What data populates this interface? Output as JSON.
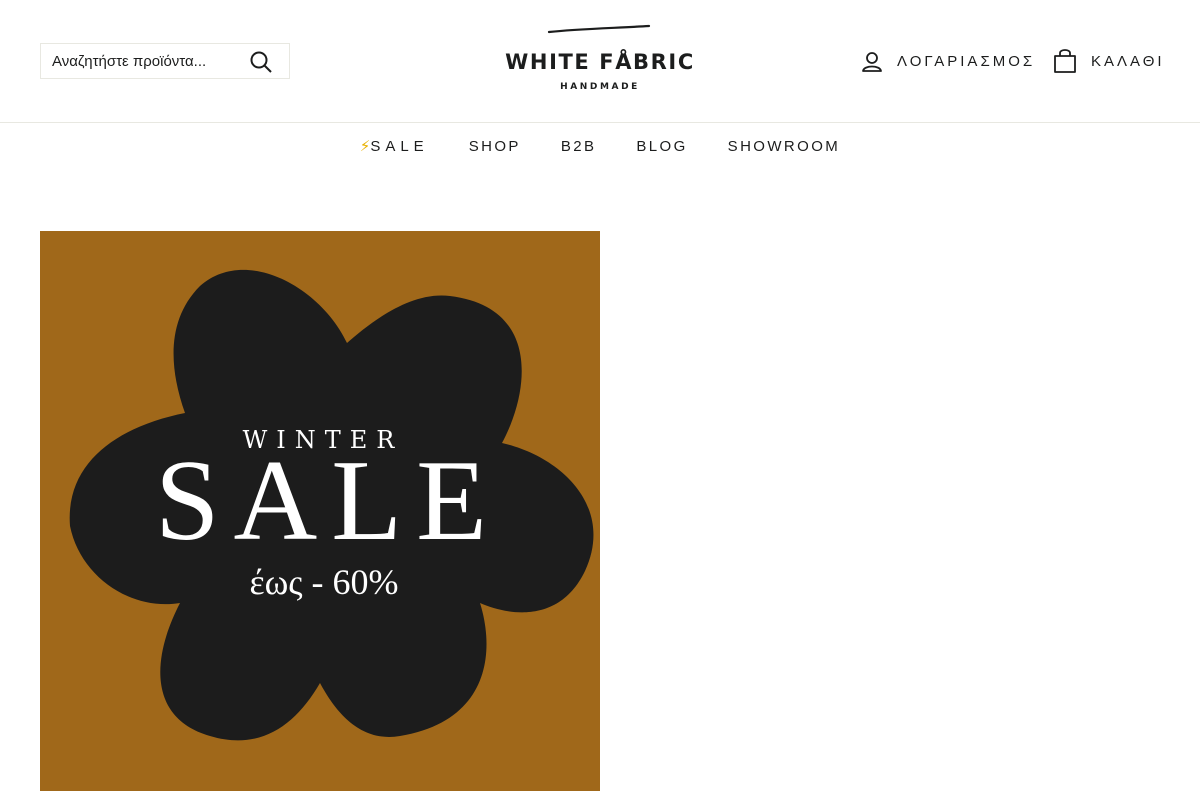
{
  "search": {
    "placeholder": "Αναζητήστε προϊόντα..."
  },
  "logo": {
    "wordmark": "WHITE FÅBRIC",
    "tagline": "HANDMADE"
  },
  "header": {
    "account_label": "ΛΟΓΑΡΙΑΣΜΟΣ",
    "cart_label": "ΚΑΛΑΘΙ"
  },
  "nav": {
    "items": [
      {
        "label": "SALE",
        "icon": "lightning-bolt-icon"
      },
      {
        "label": "SHOP"
      },
      {
        "label": "B2B"
      },
      {
        "label": "BLOG"
      },
      {
        "label": "SHOWROOM"
      }
    ]
  },
  "promo": {
    "line1": "WINTER",
    "line2": "SALE",
    "line3": "έως - 60%",
    "background_color": "#a0681a",
    "shape_color": "#1c1c1c",
    "text_color": "#ffffff"
  },
  "icons": {
    "search": "search-icon",
    "account": "user-icon",
    "cart": "shopping-bag-icon"
  }
}
